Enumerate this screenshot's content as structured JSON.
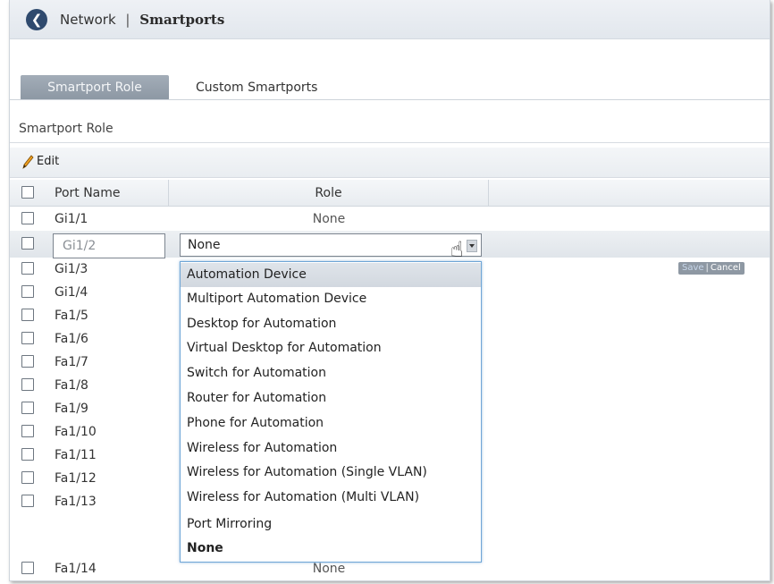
{
  "header": {
    "back_icon": "back-arrow-icon",
    "section": "Network",
    "separator": "|",
    "title": "Smartports"
  },
  "tabs": [
    {
      "label": "Smartport Role",
      "active": true
    },
    {
      "label": "Custom Smartports",
      "active": false
    }
  ],
  "section_title": "Smartport Role",
  "toolbar": {
    "edit_label": "Edit",
    "edit_icon": "pencil-icon"
  },
  "table": {
    "columns": {
      "port_name": "Port Name",
      "role": "Role"
    },
    "rows": [
      {
        "port": "Gi1/1",
        "role": "None"
      },
      {
        "port": "Gi1/2",
        "role": "None",
        "editing": true
      },
      {
        "port": "Gi1/3",
        "role": ""
      },
      {
        "port": "Gi1/4",
        "role": ""
      },
      {
        "port": "Fa1/5",
        "role": ""
      },
      {
        "port": "Fa1/6",
        "role": ""
      },
      {
        "port": "Fa1/7",
        "role": ""
      },
      {
        "port": "Fa1/8",
        "role": ""
      },
      {
        "port": "Fa1/9",
        "role": ""
      },
      {
        "port": "Fa1/10",
        "role": ""
      },
      {
        "port": "Fa1/11",
        "role": ""
      },
      {
        "port": "Fa1/12",
        "role": ""
      },
      {
        "port": "Fa1/13",
        "role": ""
      },
      {
        "port": "Fa1/14",
        "role": "None"
      }
    ]
  },
  "editor": {
    "port_value": "Gi1/2",
    "selected_role": "None",
    "save_label": "Save",
    "separator": "|",
    "cancel_label": "Cancel"
  },
  "dropdown_options": [
    "Automation Device",
    "Multiport Automation Device",
    "Desktop for Automation",
    "Virtual Desktop for Automation",
    "Switch for Automation",
    "Router for Automation",
    "Phone for Automation",
    "Wireless for Automation",
    "Wireless for Automation (Single VLAN)",
    "Wireless for Automation (Multi VLAN)",
    "Port Mirroring",
    "None"
  ],
  "colors": {
    "accent": "#6fa6d6",
    "active_tab": "#97a2ad",
    "header_bg": "#e6eaef"
  }
}
